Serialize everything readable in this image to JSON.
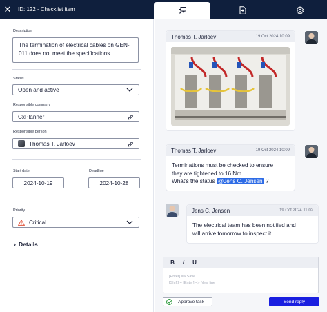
{
  "header": {
    "title": "ID: 122 - Checklist item",
    "tabs": [
      {
        "icon": "chat-icon",
        "active": true
      },
      {
        "icon": "document-add-icon",
        "active": false
      },
      {
        "icon": "gear-icon",
        "active": false
      }
    ]
  },
  "form": {
    "description": {
      "label": "Description",
      "value": "The termination of electrical cables on GEN-011 does not meet the specifications."
    },
    "status": {
      "label": "Status",
      "value": "Open and active"
    },
    "responsible_company": {
      "label": "Responsible company",
      "value": "CxPlanner"
    },
    "responsible_person": {
      "label": "Responsible person",
      "value": "Thomas T. Jarloev"
    },
    "start_date": {
      "label": "Start date",
      "value": "2024-10-19"
    },
    "deadline": {
      "label": "Deadline",
      "value": "2024-10-28"
    },
    "priority": {
      "label": "Priority",
      "value": "Critical",
      "color": "#e0533b"
    },
    "details_label": "Details"
  },
  "messages": [
    {
      "author": "Thomas T. Jarloev",
      "time": "19 Oct 2024 10:09",
      "type": "image",
      "side": "right"
    },
    {
      "author": "Thomas T. Jarloev",
      "time": "19 Oct 2024 10:09",
      "side": "right",
      "text_line1": "Terminations must be checked to ensure",
      "text_line2": "they are tightened to 16 Nm.",
      "text_line3_before": "What's the status",
      "mention": "@Jens C. Jensen",
      "text_line3_after": "?"
    },
    {
      "author": "Jens C. Jensen",
      "time": "19 Oct 2024 11:02",
      "side": "left",
      "text_line1": "The electrical team has been notified and",
      "text_line2": "will arrive tomorrow to inspect it."
    }
  ],
  "editor": {
    "bold": "B",
    "italic": "I",
    "underline": "U",
    "hint_send": "[Enter] => Save",
    "hint_newline": "[Shift] + [Enter] => New line"
  },
  "actions": {
    "approve_label": "Approve task",
    "send_label": "Send reply"
  },
  "colors": {
    "header_bg": "#0f1f3d",
    "mention_bg": "#2e6ce6",
    "send_bg": "#1a1fe0"
  }
}
